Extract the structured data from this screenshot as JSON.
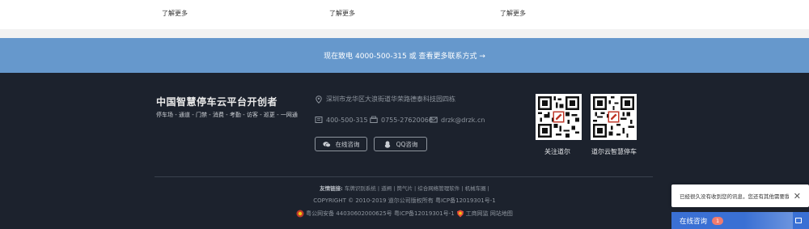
{
  "top": {
    "learn_more_1": "了解更多",
    "learn_more_2": "了解更多",
    "learn_more_3": "了解更多"
  },
  "contact_banner": {
    "text": "现在致电 4000-500-315 或 查看更多联系方式 →"
  },
  "footer": {
    "brand_title": "中国智慧停车云平台开创者",
    "brand_subtitle": "停车场 - 通道 - 门禁 - 消费 - 考勤 - 访客 - 巡更 - 一网通",
    "address": "深圳市龙华区大浪街道华荣路德泰科技园四栋",
    "phone": "400-500-315",
    "tel": "0755-27620066",
    "email": "drzk@drzk.cn",
    "btn_online": "在线咨询",
    "btn_qq": "QQ咨询",
    "qr1_label": "关注道尔",
    "qr2_label": "道尔云智慧停车",
    "links_label": "友情链接:",
    "links": [
      "车牌识别系统",
      "道闸",
      "筒气片",
      "综合网络管理软件",
      "机械车圈"
    ],
    "copyright": "COPYRIGHT © 2010-2019 道尔公司版权所有  粤ICP备12019301号-1",
    "police_record": "粤公网安备 44030602000625号  粤ICP备12019301号-1",
    "gov_label": "工商网监  网站地图"
  },
  "chat": {
    "popup_message": "已经很久没有收到您的讯息，您还有其他需要我...",
    "bar_label": "在线咨询",
    "unread_count": "1"
  },
  "colors": {
    "banner": "#6698cc",
    "footer_bg": "#1c222d",
    "chat_bar": "#3a70d4"
  }
}
